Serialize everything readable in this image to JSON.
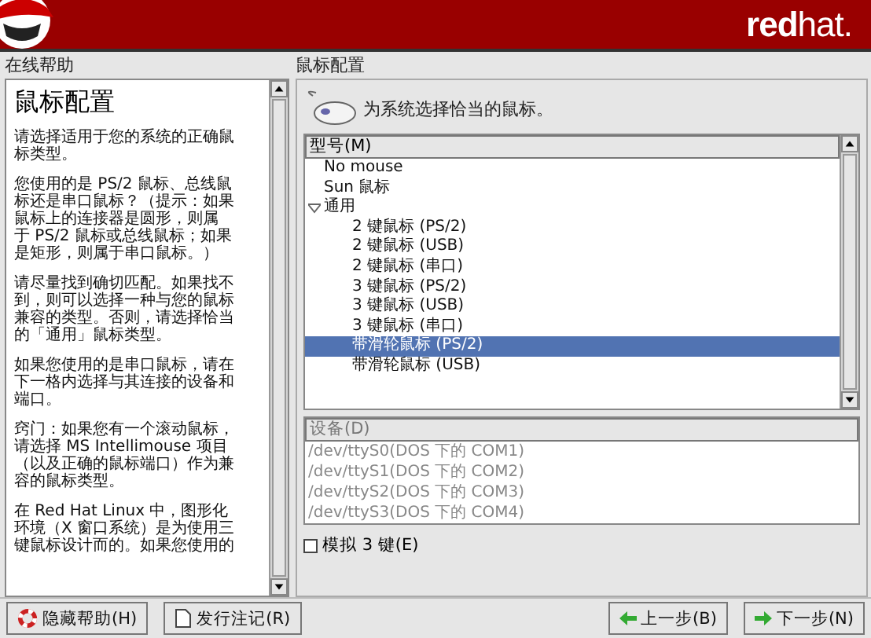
{
  "header": {
    "brand": "**red**hat."
  },
  "help": {
    "label": "在线帮助",
    "title": "鼠标配置",
    "paragraphs": [
      [
        "请选择适用于您的系统的正确鼠",
        "标类型。"
      ],
      [
        "您使用的是 PS/2 鼠标、总线鼠",
        "标还是串口鼠标？（提示：如果",
        "鼠标上的连接器是圆形，则属",
        "于 PS/2 鼠标或总线鼠标；如果",
        "是矩形，则属于串口鼠标。）"
      ],
      [
        "请尽量找到确切匹配。如果找不",
        "到，则可以选择一种与您的鼠标",
        "兼容的类型。否则，请选择恰当",
        "的「通用」鼠标类型。"
      ],
      [
        "如果您使用的是串口鼠标，请在",
        "下一格内选择与其连接的设备和",
        "端口。"
      ],
      [
        "窍门：如果您有一个滚动鼠标，",
        "请选择 MS Intellimouse 项目",
        "（以及正确的鼠标端口）作为兼",
        "容的鼠标类型。"
      ],
      [
        "在 Red Hat Linux 中，图形化",
        "环境（X 窗口系统）是为使用三",
        "键鼠标设计而的。如果您使用的"
      ]
    ]
  },
  "config": {
    "label": "鼠标配置",
    "intro": "为系统选择恰当的鼠标。",
    "model_header": "型号(M)",
    "models": [
      {
        "label": "No mouse",
        "selected": false
      },
      {
        "label": "Sun 鼠标",
        "selected": false
      },
      {
        "label": "通用",
        "selected": false,
        "expanded": true,
        "children": [
          {
            "label": "2 键鼠标 (PS/2)",
            "selected": false
          },
          {
            "label": "2 键鼠标 (USB)",
            "selected": false
          },
          {
            "label": "2 键鼠标 (串口)",
            "selected": false
          },
          {
            "label": "3 键鼠标 (PS/2)",
            "selected": false
          },
          {
            "label": "3 键鼠标 (USB)",
            "selected": false
          },
          {
            "label": "3 键鼠标 (串口)",
            "selected": false
          },
          {
            "label": "带滑轮鼠标 (PS/2)",
            "selected": true
          },
          {
            "label": "带滑轮鼠标 (USB)",
            "selected": false
          }
        ]
      }
    ],
    "device_header": "设备(D)",
    "devices_disabled": true,
    "devices": [
      "/dev/ttyS0(DOS 下的 COM1)",
      "/dev/ttyS1(DOS 下的 COM2)",
      "/dev/ttyS2(DOS 下的 COM3)",
      "/dev/ttyS3(DOS 下的 COM4)"
    ],
    "emulate": {
      "label": "模拟 3 键(E)",
      "checked": false
    }
  },
  "buttons": {
    "hide_help": "隐藏帮助(H)",
    "release_notes": "发行注记(R)",
    "back": "上一步(B)",
    "next": "下一步(N)"
  }
}
